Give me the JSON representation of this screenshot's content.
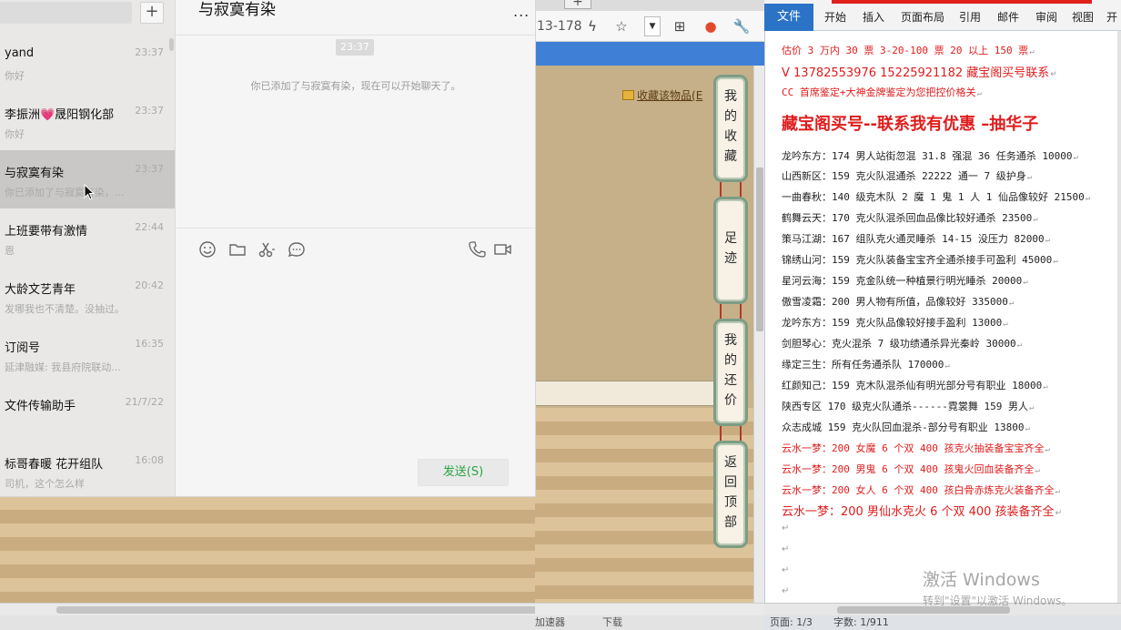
{
  "wechat": {
    "chats": [
      {
        "name": "yand",
        "time": "23:37",
        "preview": "你好",
        "active": false
      },
      {
        "name": "李振洲💗晟阳钢化部",
        "time": "23:37",
        "preview": "你好",
        "active": false
      },
      {
        "name": "与寂寞有染",
        "time": "23:37",
        "preview": "你已添加了与寂寞有染，...",
        "active": true
      },
      {
        "name": "上班要带有激情",
        "time": "22:44",
        "preview": "恩",
        "active": false
      },
      {
        "name": "大龄文艺青年",
        "time": "20:42",
        "preview": "发哪我也不清楚。没抽过。",
        "active": false
      },
      {
        "name": "订阅号",
        "time": "16:35",
        "preview": "延津融媒: 我县府院联动...",
        "active": false
      },
      {
        "name": "文件传输助手",
        "time": "21/7/22",
        "preview": "",
        "active": false
      },
      {
        "name": "标哥春暖 花开组队",
        "time": "16:08",
        "preview": "司机，这个怎么样",
        "active": false
      }
    ],
    "add_label": "+",
    "conversation": {
      "title": "与寂寞有染",
      "more_label": "...",
      "timestamp": "23:37",
      "system_message": "你已添加了与寂寞有染，现在可以开始聊天了。",
      "send_label": "发送(S)"
    }
  },
  "browser": {
    "url_fragment": "13-178",
    "new_tab_label": "+",
    "favorite_label": "收藏该物品",
    "favorite_suffix": "(E",
    "sidenav": [
      {
        "label": "我的收藏",
        "chars": [
          "我",
          "的",
          "收",
          "藏"
        ]
      },
      {
        "label": "足迹",
        "chars": [
          "足",
          "迹"
        ]
      },
      {
        "label": "我的还价",
        "chars": [
          "我",
          "的",
          "还",
          "价"
        ]
      },
      {
        "label": "返回顶部",
        "chars": [
          "返",
          "回",
          "顶",
          "部"
        ]
      }
    ],
    "status": {
      "accelerator": "加速器",
      "download": "下载"
    }
  },
  "word": {
    "tabs": [
      "文件",
      "开始",
      "插入",
      "页面布局",
      "引用",
      "邮件",
      "审阅",
      "视图",
      "开"
    ],
    "lines": [
      {
        "text": "估价 3 万内 30 票    3-20-100 票      20 以上 150 票",
        "style": "red"
      },
      {
        "text": "V 13782553976   15225921182  藏宝阁买号联系",
        "style": "mid"
      },
      {
        "text": "CC 首席鉴定+大神金牌鉴定为您把控价格关",
        "style": "red"
      },
      {
        "text": "藏宝阁买号--联系我有优惠 –抽华子",
        "style": "big"
      },
      {
        "text": "龙吟东方：174 男人站街忽混 31.8 强混 36 任务通杀 10000",
        "style": "normal"
      },
      {
        "text": "山西新区：159 克火队混通杀 22222 通一 7 级护身",
        "style": "normal"
      },
      {
        "text": "一曲春秋：140 级克木队 2 魔 1 鬼 1 人 1 仙品像较好 21500",
        "style": "normal"
      },
      {
        "text": "鹤舞云天：170 克火队混杀回血品像比较好通杀 23500",
        "style": "normal"
      },
      {
        "text": "策马江湖：167 组队克火通灵睡杀 14-15 没压力 82000",
        "style": "normal"
      },
      {
        "text": "锦绣山河：159 克火队装备宝宝齐全通杀接手可盈利 45000",
        "style": "normal"
      },
      {
        "text": "星河云海：159 克金队统一种植景行明光睡杀 20000",
        "style": "normal"
      },
      {
        "text": "傲雪凌霜：200 男人物有所值，品像较好 335000",
        "style": "normal"
      },
      {
        "text": "龙吟东方：159 克火队品像较好接手盈利 13000",
        "style": "normal"
      },
      {
        "text": "剑胆琴心：克火混杀 7 级功绩通杀异光秦岭 30000",
        "style": "normal"
      },
      {
        "text": "缘定三生：所有任务通杀队 170000",
        "style": "normal"
      },
      {
        "text": "红颜知己：159 克木队混杀仙有明光部分号有职业 18000",
        "style": "normal"
      },
      {
        "text": "陕西专区 170 级克火队通杀------霓裳舞 159 男人",
        "style": "normal"
      },
      {
        "text": "众志成城 159 克火队回血混杀-部分号有职业 13800",
        "style": "normal"
      },
      {
        "text": "云水一梦：200 女魔 6 个双 400 孩克火抽装备宝宝齐全",
        "style": "red"
      },
      {
        "text": "云水一梦：200 男鬼 6 个双 400 孩鬼火回血装备齐全",
        "style": "red"
      },
      {
        "text": "云水一梦：200 女人 6 个双 400 孩白骨赤炼克火装备齐全",
        "style": "red"
      },
      {
        "text": "云水一梦：200 男仙水克火 6 个双 400 孩装备齐全",
        "style": "mid"
      }
    ],
    "para_mark": "↵",
    "status": {
      "page": "页面: 1/3",
      "words": "字数: 1/911"
    }
  },
  "watermark": {
    "line1": "激活 Windows",
    "line2": "转到\"设置\"以激活 Windows。"
  },
  "colors": {
    "wechat_green": "#2aa544",
    "word_blue": "#2b73c7",
    "red_text": "#e01c1c"
  }
}
